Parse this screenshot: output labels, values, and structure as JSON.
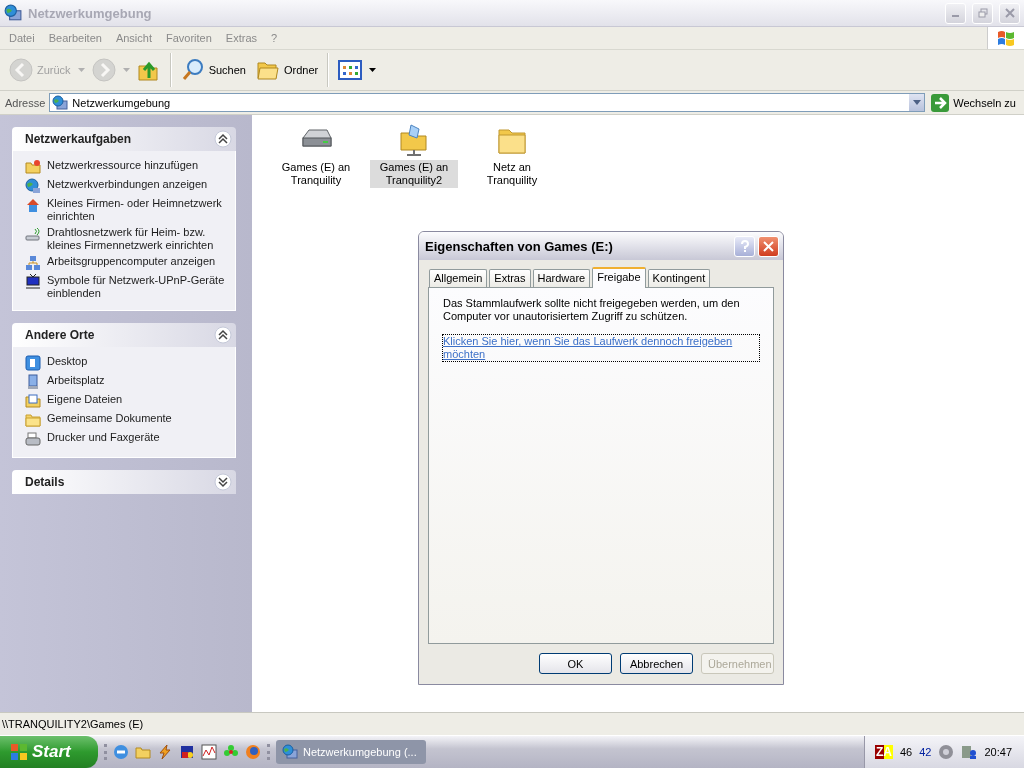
{
  "window": {
    "title": "Netzwerkumgebung",
    "active": false
  },
  "menu": [
    "Datei",
    "Bearbeiten",
    "Ansicht",
    "Favoriten",
    "Extras",
    "?"
  ],
  "toolbar": [
    {
      "kind": "back",
      "label": "Zurück",
      "disabled": true
    },
    {
      "kind": "forward",
      "disabled": true
    },
    {
      "kind": "up",
      "disabled": false
    },
    {
      "kind": "search",
      "label": "Suchen",
      "disabled": false
    },
    {
      "kind": "folders",
      "label": "Ordner",
      "disabled": false
    },
    {
      "kind": "views",
      "disabled": false
    }
  ],
  "address": {
    "label": "Adresse",
    "value": "Netzwerkumgebung",
    "go": "Wechseln zu"
  },
  "sidebar": [
    {
      "title": "Netzwerkaufgaben",
      "expanded": true,
      "items": [
        "Netzwerkressource hinzufügen",
        "Netzwerkverbindungen anzeigen",
        "Kleines Firmen- oder Heimnetzwerk einrichten",
        "Drahtlosnetzwerk für Heim- bzw. kleines Firmennetzwerk einrichten",
        "Arbeitsgruppencomputer anzeigen",
        "Symbole für Netzwerk-UPnP-Geräte einblenden"
      ]
    },
    {
      "title": "Andere Orte",
      "expanded": true,
      "items": [
        "Desktop",
        "Arbeitsplatz",
        "Eigene Dateien",
        "Gemeinsame Dokumente",
        "Drucker und Faxgeräte"
      ]
    },
    {
      "title": "Details",
      "expanded": false
    }
  ],
  "files": [
    {
      "label": "Games (E) an Tranquility",
      "kind": "drive",
      "selected": false
    },
    {
      "label": "Games (E) an Tranquility2",
      "kind": "share",
      "selected": true
    },
    {
      "label": "Netz an Tranquility",
      "kind": "folder",
      "selected": false
    }
  ],
  "dialog": {
    "title": "Eigenschaften von Games (E:)",
    "tabs": [
      {
        "label": "Allgemein",
        "selected": false
      },
      {
        "label": "Extras",
        "selected": false
      },
      {
        "label": "Hardware",
        "selected": false
      },
      {
        "label": "Freigabe",
        "selected": true
      },
      {
        "label": "Kontingent",
        "selected": false
      }
    ],
    "text": "Das Stammlaufwerk sollte nicht freigegeben werden, um den Computer vor unautorisiertem Zugriff zu schützen.",
    "link": "Klicken Sie hier, wenn Sie das Laufwerk dennoch freigeben möchten",
    "buttons": [
      {
        "label": "OK",
        "disabled": false
      },
      {
        "label": "Abbrechen",
        "disabled": false
      },
      {
        "label": "Übernehmen",
        "disabled": true
      }
    ]
  },
  "status_bar": "\\\\TRANQUILITY2\\Games (E)",
  "taskbar": {
    "start": "Start",
    "task": "Netzwerkumgebung (...",
    "tray": {
      "badge": "ZA",
      "readings": [
        "46",
        "42"
      ],
      "clock": "20:47"
    }
  }
}
